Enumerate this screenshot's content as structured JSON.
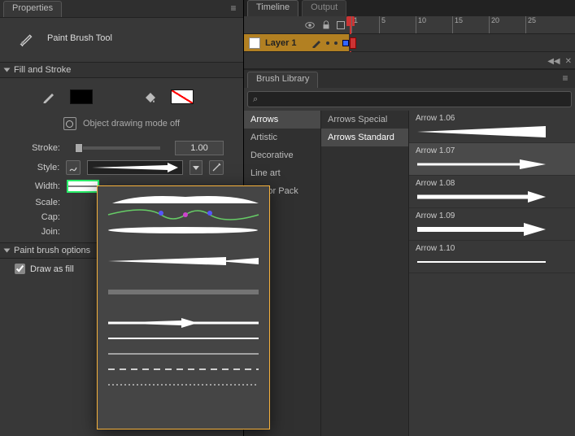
{
  "props": {
    "tab": "Properties",
    "tool_name": "Paint Brush Tool"
  },
  "fill": {
    "heading": "Fill and Stroke",
    "obj_draw": "Object drawing mode off",
    "stroke_label": "Stroke:",
    "stroke_value": "1.00",
    "style_label": "Style:",
    "width_label": "Width:",
    "scale_label": "Scale:",
    "cap_label": "Cap:",
    "join_label": "Join:"
  },
  "pbo": {
    "heading": "Paint brush options",
    "draw_as_fill": "Draw as fill"
  },
  "timeline": {
    "tabs": [
      "Timeline",
      "Output"
    ],
    "layer": "Layer 1",
    "ticks": [
      1,
      5,
      10,
      15,
      20,
      25
    ]
  },
  "lib": {
    "tab": "Brush Library",
    "search_icon": "⌕",
    "categories": [
      "Arrows",
      "Artistic",
      "Decorative",
      "Line art",
      "Vector Pack"
    ],
    "cat_sel": 0,
    "subcats": [
      "Arrows Special",
      "Arrows Standard"
    ],
    "subcat_sel": 1,
    "brushes": [
      "Arrow 1.06",
      "Arrow 1.07",
      "Arrow 1.08",
      "Arrow 1.09",
      "Arrow 1.10"
    ],
    "brush_sel": 1
  }
}
